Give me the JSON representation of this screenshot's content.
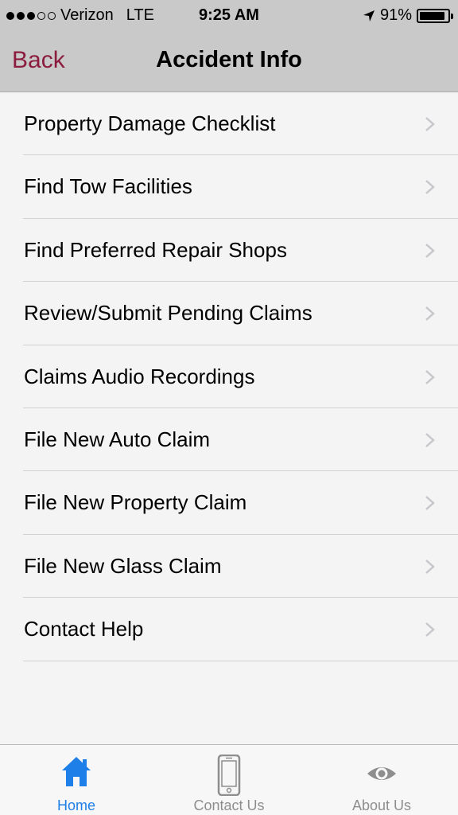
{
  "status_bar": {
    "carrier": "Verizon",
    "network": "LTE",
    "time": "9:25 AM",
    "battery": "91%",
    "battery_level": 0.91,
    "signal_bars": 3,
    "signal_total": 5
  },
  "nav": {
    "back_label": "Back",
    "title": "Accident Info"
  },
  "menu": {
    "items": [
      {
        "label": "Property Damage Checklist"
      },
      {
        "label": "Find Tow Facilities"
      },
      {
        "label": "Find Preferred Repair Shops"
      },
      {
        "label": "Review/Submit Pending Claims"
      },
      {
        "label": "Claims Audio Recordings"
      },
      {
        "label": "File New Auto Claim"
      },
      {
        "label": "File New Property Claim"
      },
      {
        "label": "File New Glass Claim"
      },
      {
        "label": "Contact Help"
      }
    ]
  },
  "tabs": {
    "home": {
      "label": "Home",
      "icon": "home-icon",
      "active": true
    },
    "contact": {
      "label": "Contact Us",
      "icon": "phone-icon",
      "active": false
    },
    "about": {
      "label": "About Us",
      "icon": "eye-icon",
      "active": false
    }
  },
  "colors": {
    "accent": "#1e7fe8",
    "back": "#8b1c3d",
    "bar": "#c9c9c9"
  }
}
